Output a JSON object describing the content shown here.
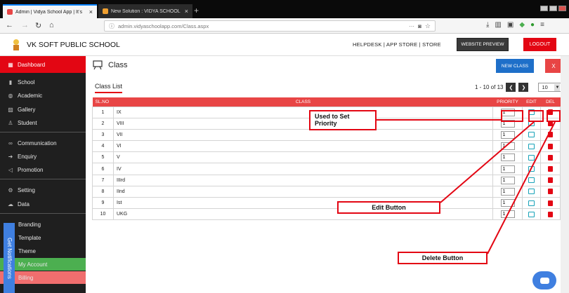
{
  "browser": {
    "tabs": [
      {
        "label": "Admin | Vidya School App | Itʼs",
        "active": true
      },
      {
        "label": "New Solution : VIDYA SCHOOL",
        "active": false
      }
    ],
    "new_tab_symbol": "+",
    "url": "admin.vidyaschoolapp.com/Class.aspx",
    "icons": [
      "back-icon",
      "forward-icon",
      "reload-icon",
      "home-icon",
      "info-icon",
      "pocket-icon",
      "star-icon",
      "download-icon",
      "library-icon",
      "sidebar-icon",
      "shield-icon",
      "chrome-ext-icon",
      "menu-icon"
    ]
  },
  "header": {
    "school_name": "VK SOFT PUBLIC SCHOOL",
    "links": "HELPDESK  |  APP STORE  |  STORE",
    "website_preview": "WEBSITE PREVIEW",
    "logout": "LOGOUT"
  },
  "sidebar": {
    "items": [
      {
        "label": "Dashboard",
        "icon": "grid-icon"
      },
      {
        "label": "School",
        "icon": "chart-icon"
      },
      {
        "label": "Academic",
        "icon": "globe-icon"
      },
      {
        "label": "Gallery",
        "icon": "image-icon"
      },
      {
        "label": "Student",
        "icon": "student-icon"
      },
      {
        "label": "Communication",
        "icon": "link-icon"
      },
      {
        "label": "Enquiry",
        "icon": "arrow-icon"
      },
      {
        "label": "Promotion",
        "icon": "megaphone-icon"
      },
      {
        "label": "Setting",
        "icon": "gear-icon"
      },
      {
        "label": "Data",
        "icon": "cloud-icon"
      },
      {
        "label": "Branding",
        "icon": "brand-icon"
      },
      {
        "label": "Template",
        "icon": "template-icon"
      },
      {
        "label": "Theme",
        "icon": "theme-icon"
      },
      {
        "label": "My Account",
        "icon": "user-icon"
      },
      {
        "label": "Billing",
        "icon": "billing-icon"
      }
    ],
    "notifications_tab": "Get Notifications"
  },
  "main": {
    "title": "Class",
    "new_class": "NEW CLASS",
    "close": "X",
    "list_title": "Class List",
    "pager": {
      "range": "1 - 10 of 13",
      "prev": "❮",
      "next": "❯",
      "page_size": "10",
      "dropdown": "▼"
    },
    "columns": [
      "SL.NO",
      "CLASS",
      "PRIORITY",
      "EDIT",
      "DEL"
    ],
    "rows": [
      {
        "sl": "1",
        "name": "IX",
        "priority": "1"
      },
      {
        "sl": "2",
        "name": "VIII",
        "priority": "1"
      },
      {
        "sl": "3",
        "name": "VII",
        "priority": "1"
      },
      {
        "sl": "4",
        "name": "VI",
        "priority": "1"
      },
      {
        "sl": "5",
        "name": "V",
        "priority": "1"
      },
      {
        "sl": "6",
        "name": "IV",
        "priority": "1"
      },
      {
        "sl": "7",
        "name": "IIIrd",
        "priority": "1"
      },
      {
        "sl": "8",
        "name": "IInd",
        "priority": "1"
      },
      {
        "sl": "9",
        "name": "Ist",
        "priority": "1"
      },
      {
        "sl": "10",
        "name": "UKG",
        "priority": "1"
      }
    ]
  },
  "annotations": {
    "priority": "Used to Set Priority",
    "edit": "Edit Button",
    "delete": "Delete Button"
  },
  "colors": {
    "accent_red": "#e30613",
    "table_header": "#e84545",
    "new_class_blue": "#1e6fc9",
    "account_green": "#4caf50",
    "billing_pink": "#f06e6e"
  }
}
